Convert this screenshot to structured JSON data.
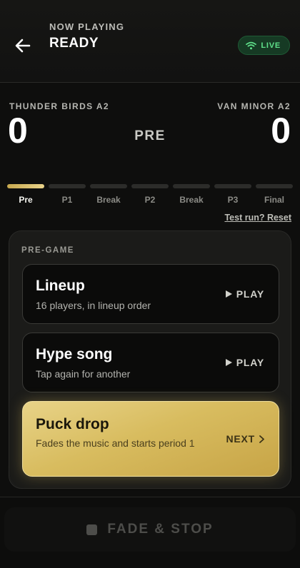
{
  "header": {
    "now_playing_label": "NOW PLAYING",
    "state": "READY",
    "live_label": "LIVE",
    "live_color": "#5fe08a"
  },
  "scoreboard": {
    "home_team": "THUNDER BIRDS A2",
    "home_score": "0",
    "away_team": "VAN MINOR A2",
    "away_score": "0",
    "current_period": "PRE"
  },
  "progress": {
    "segments": [
      "Pre",
      "P1",
      "Break",
      "P2",
      "Break",
      "P3",
      "Final"
    ],
    "active_index": 0,
    "accent": "#d8bc5f"
  },
  "reset_link": "Test run? Reset",
  "panel": {
    "title": "PRE-GAME",
    "cues": [
      {
        "title": "Lineup",
        "subtitle": "16 players, in lineup order",
        "action": "PLAY",
        "action_icon": "play-icon"
      },
      {
        "title": "Hype song",
        "subtitle": "Tap again for another",
        "action": "PLAY",
        "action_icon": "play-icon"
      },
      {
        "title": "Puck drop",
        "subtitle": "Fades the music and starts period 1",
        "action": "NEXT",
        "action_icon": "chevron-right-icon"
      }
    ]
  },
  "footer": {
    "fade_stop_label": "FADE & STOP",
    "icon": "stop-icon"
  }
}
